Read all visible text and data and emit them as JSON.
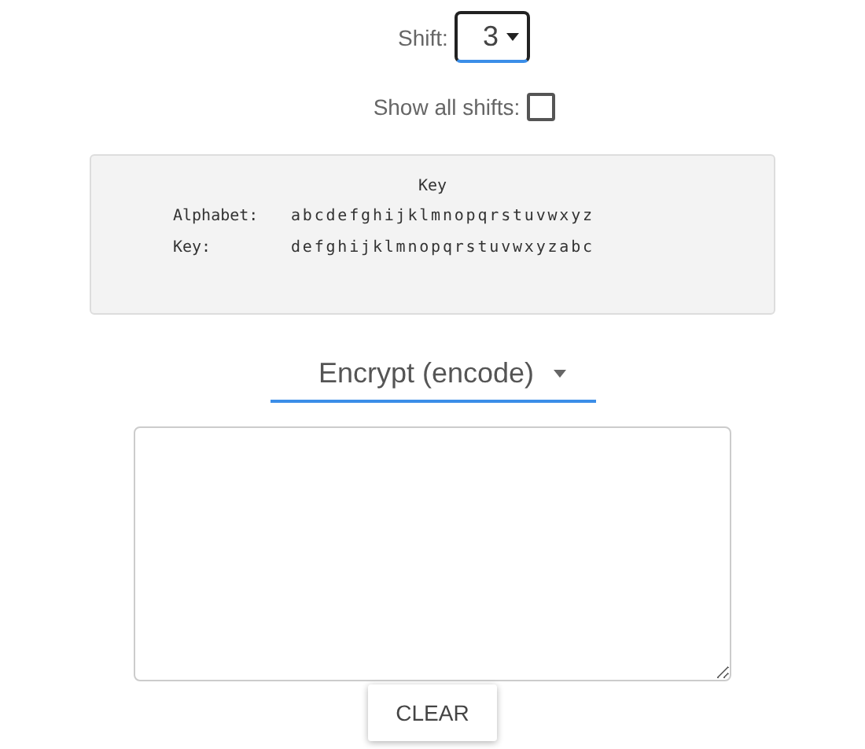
{
  "shift": {
    "label": "Shift:",
    "value": "3"
  },
  "show_all_shifts": {
    "label": "Show all shifts:",
    "checked": false
  },
  "key_panel": {
    "title": "Key",
    "rows": [
      {
        "label": "Alphabet:",
        "letters": "abcdefghijklmnopqrstuvwxyz"
      },
      {
        "label": "Key:",
        "letters": "defghijklmnopqrstuvwxyzabc"
      }
    ]
  },
  "mode": {
    "value": "Encrypt (encode)"
  },
  "buttons": [
    "CLEAR"
  ]
}
